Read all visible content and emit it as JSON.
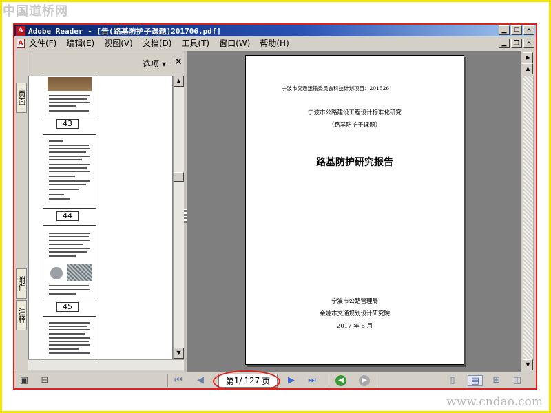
{
  "watermark": {
    "top": "中国道桥网",
    "bottom": "www.cndao.com"
  },
  "window": {
    "app_icon": "A",
    "title": "Adobe Reader - [告(路基防护子课题)201706.pdf]",
    "buttons": {
      "minimize": "▁",
      "maximize": "☐",
      "close": "✕",
      "restore": "❐"
    }
  },
  "menubar": {
    "doc_icon": "A",
    "items": [
      "文件(F)",
      "编辑(E)",
      "视图(V)",
      "文档(D)",
      "工具(T)",
      "窗口(W)",
      "帮助(H)"
    ]
  },
  "side_tabs": {
    "pages": "页面",
    "attachments": "附件",
    "comments": "注释"
  },
  "nav_panel": {
    "options_label": "选项 ▾",
    "close_label": "✕",
    "thumbnails": [
      {
        "label": "43"
      },
      {
        "label": "44"
      },
      {
        "label": "45"
      },
      {
        "label": ""
      }
    ]
  },
  "document": {
    "project_line": "宁波市交通运输委员会科技计划项目：201526",
    "subtitle1": "宁波市公路建设工程设计标准化研究",
    "subtitle2": "（路基防护子课题）",
    "main_title": "路基防护研究报告",
    "org1": "宁波市公路管理局",
    "org2": "余姚市交通规划设计研究院",
    "date": "2017 年 6 月"
  },
  "bottombar": {
    "page_prefix": "第",
    "current_page": "1",
    "page_sep": "/",
    "total_pages": "127",
    "page_suffix": "页"
  },
  "icons": {
    "first_page": "first-page-icon",
    "prev_page": "prev-page-icon",
    "next_page": "next-page-icon",
    "last_page": "last-page-icon",
    "back": "go-back-icon",
    "forward": "go-forward-icon"
  },
  "colors": {
    "highlight_red": "#e0201a",
    "frame_yellow": "#f7e600",
    "title_blue": "#0a246a",
    "nav_green": "#3a9a3a"
  }
}
